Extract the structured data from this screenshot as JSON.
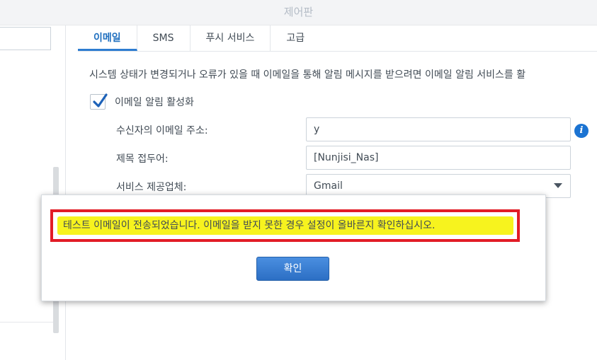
{
  "window": {
    "title": "제어판"
  },
  "tabs": [
    {
      "label": "이메일",
      "active": true
    },
    {
      "label": "SMS",
      "active": false
    },
    {
      "label": "푸시 서비스",
      "active": false
    },
    {
      "label": "고급",
      "active": false
    }
  ],
  "email": {
    "description": "시스템 상태가 변경되거나 오류가 있을 때 이메일을 통해 알림 메시지를 받으려면 이메일 알림 서비스를 활",
    "enable_label": "이메일 알림 활성화",
    "enable_checked": true,
    "recipient_label": "수신자의 이메일 주소:",
    "recipient_value": "y",
    "subject_label": "제목 접두어:",
    "subject_value": "[Nunjisi_Nas]",
    "provider_label": "서비스 제공업체:",
    "provider_value": "Gmail"
  },
  "dialog": {
    "message": "테스트 이메일이 전송되었습니다. 이메일을 받지 못한 경우 설정이 올바른지 확인하십시오.",
    "ok_label": "확인"
  },
  "colors": {
    "accent": "#2e7dd1",
    "annotation_border": "#e21c26",
    "highlighter": "#f7f31e"
  }
}
